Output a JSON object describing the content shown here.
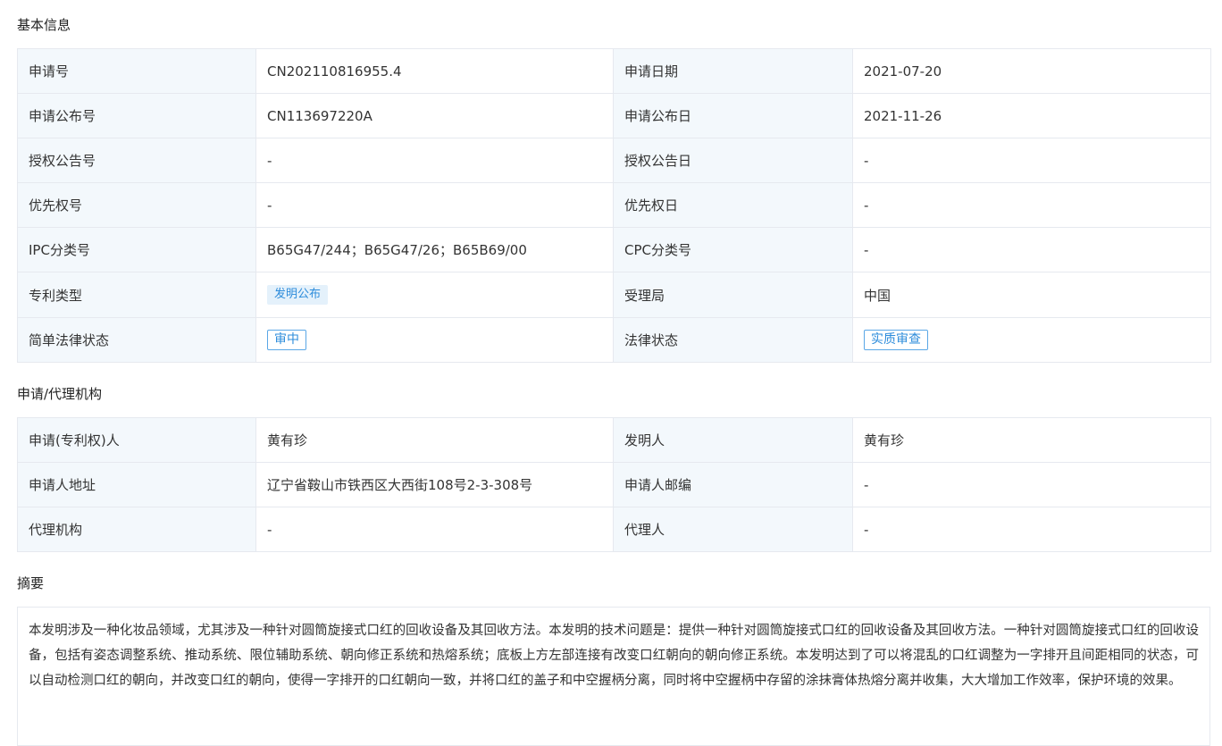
{
  "sections": {
    "basic": "基本信息",
    "agency": "申请/代理机构",
    "abstract": "摘要"
  },
  "basic": {
    "app_no_label": "申请号",
    "app_no": "CN202110816955.4",
    "app_date_label": "申请日期",
    "app_date": "2021-07-20",
    "pub_no_label": "申请公布号",
    "pub_no": "CN113697220A",
    "pub_date_label": "申请公布日",
    "pub_date": "2021-11-26",
    "grant_no_label": "授权公告号",
    "grant_no": "-",
    "grant_date_label": "授权公告日",
    "grant_date": "-",
    "priority_no_label": "优先权号",
    "priority_no": "-",
    "priority_date_label": "优先权日",
    "priority_date": "-",
    "ipc_label": "IPC分类号",
    "ipc": "B65G47/244；B65G47/26；B65B69/00",
    "cpc_label": "CPC分类号",
    "cpc": "-",
    "type_label": "专利类型",
    "type_tag": "发明公布",
    "office_label": "受理局",
    "office": "中国",
    "simple_status_label": "简单法律状态",
    "simple_status_tag": "审中",
    "legal_status_label": "法律状态",
    "legal_status_tag": "实质审查"
  },
  "agency": {
    "applicant_label": "申请(专利权)人",
    "applicant": "黄有珍",
    "inventor_label": "发明人",
    "inventor": "黄有珍",
    "address_label": "申请人地址",
    "address": "辽宁省鞍山市铁西区大西街108号2-3-308号",
    "postcode_label": "申请人邮编",
    "postcode": "-",
    "agency_label": "代理机构",
    "agency": "-",
    "agent_label": "代理人",
    "agent": "-"
  },
  "abstract_text": "本发明涉及一种化妆品领域，尤其涉及一种针对圆筒旋接式口红的回收设备及其回收方法。本发明的技术问题是：提供一种针对圆筒旋接式口红的回收设备及其回收方法。一种针对圆筒旋接式口红的回收设备，包括有姿态调整系统、推动系统、限位辅助系统、朝向修正系统和热熔系统；底板上方左部连接有改变口红朝向的朝向修正系统。本发明达到了可以将混乱的口红调整为一字排开且间距相同的状态，可以自动检测口红的朝向，并改变口红的朝向，使得一字排开的口红朝向一致，并将口红的盖子和中空握柄分离，同时将中空握柄中存留的涂抹膏体热熔分离并收集，大大增加工作效率，保护环境的效果。"
}
